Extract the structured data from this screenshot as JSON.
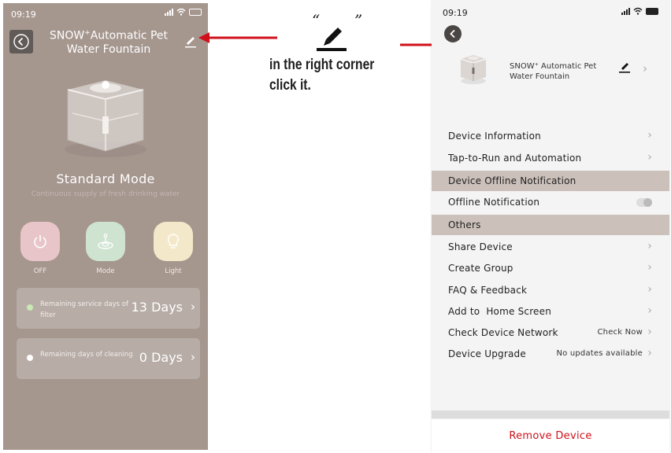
{
  "colors": {
    "left_bg": "#a5968e",
    "accent_red": "#d0101b",
    "power_bg": "#e8c5c8",
    "mode_bg": "#cfe3d1",
    "light_bg": "#f3e8c9",
    "dot_green": "#c9e8b5",
    "dot_white": "#ffffff",
    "section_bg": "#cbc0ba"
  },
  "left": {
    "status_time": "09:19",
    "title_brand": "SNOW",
    "title_sup": "+",
    "title_rest": "Automatic Pet",
    "title_line2": "Water Fountain",
    "mode_title": "Standard Mode",
    "mode_subtitle": "Continuous supply of fresh drinking water",
    "controls": [
      {
        "label": "OFF",
        "icon": "power-icon"
      },
      {
        "label": "Mode",
        "icon": "fountain-mode-icon"
      },
      {
        "label": "Light",
        "icon": "bulb-icon"
      }
    ],
    "filter_card": {
      "desc": "Remaining service days of filter",
      "value": "13 Days"
    },
    "cleaning_card": {
      "desc": "Remaining days of cleaning",
      "value": "0 Days"
    }
  },
  "callout": {
    "quote_open": "“",
    "quote_close": "”",
    "line1": "in the right corner",
    "line2": "click it."
  },
  "right": {
    "status_time": "09:19",
    "device_name": "SNOW⁺ Automatic Pet Water Fountain",
    "rows": {
      "device_info": "Device Information",
      "tap_to_run": "Tap-to-Run and Automation",
      "offline_section": "Device Offline Notification",
      "offline_notification": "Offline Notification",
      "others_section": "Others",
      "share_device": "Share Device",
      "create_group": "Create Group",
      "faq": "FAQ & Feedback",
      "add_home": "Add to  Home Screen",
      "check_network": "Check Device Network",
      "check_network_value": "Check Now",
      "device_upgrade": "Device Upgrade",
      "device_upgrade_value": "No updates available"
    },
    "remove_device": "Remove Device",
    "offline_toggle_on": false
  }
}
